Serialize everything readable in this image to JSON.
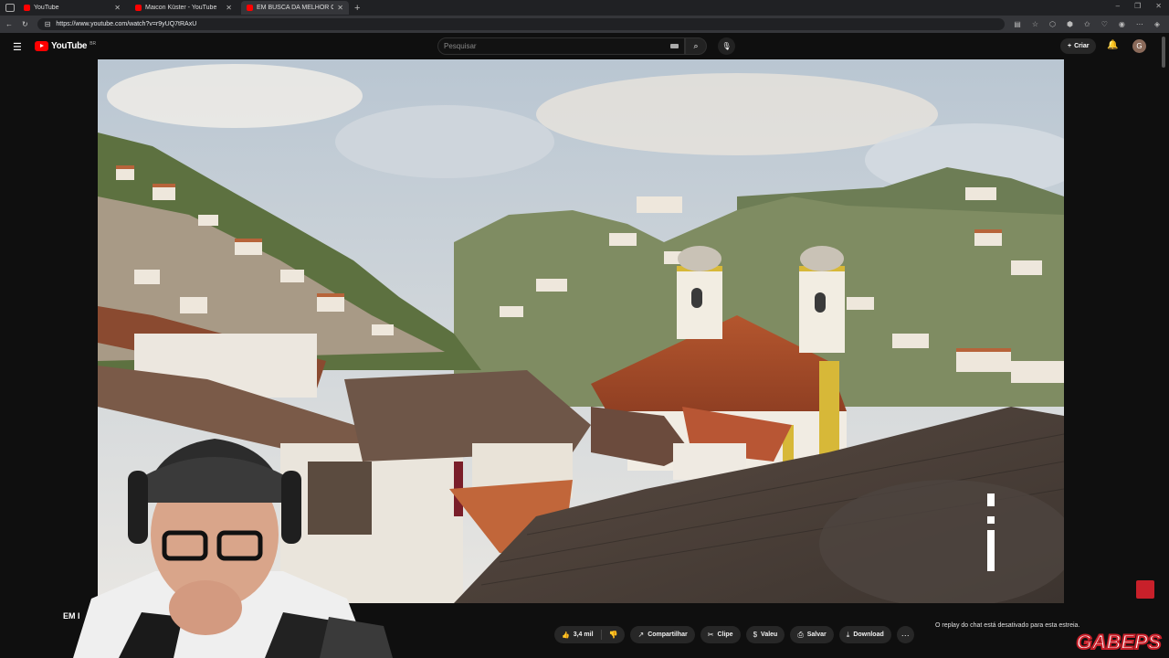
{
  "browser": {
    "tabs": [
      {
        "title": "YouTube",
        "active": false
      },
      {
        "title": "Maicon Küster - YouTube",
        "active": false
      },
      {
        "title": "EM BUSCA DA MELHOR CO...",
        "active": true
      }
    ],
    "new_tab_glyph": "+",
    "url": "https://www.youtube.com/watch?v=r9yUQ7tRAxU"
  },
  "youtube": {
    "logo_text": "YouTube",
    "country_code": "BR",
    "search_placeholder": "Pesquisar",
    "create_label": "Criar",
    "avatar_letter": "G"
  },
  "video": {
    "title_fragment": "EM I"
  },
  "actions": {
    "likes": "3,4 mil",
    "share": "Compartilhar",
    "clip": "Clipe",
    "thanks": "Valeu",
    "save": "Salvar",
    "download": "Download",
    "more": "···"
  },
  "chat": {
    "note": "O replay do chat está desativado para esta estreia."
  },
  "overlay": {
    "brand": "GABEPS"
  },
  "colors": {
    "accent": "#ff0000",
    "background": "#0f0f0f",
    "pill": "#272727"
  }
}
